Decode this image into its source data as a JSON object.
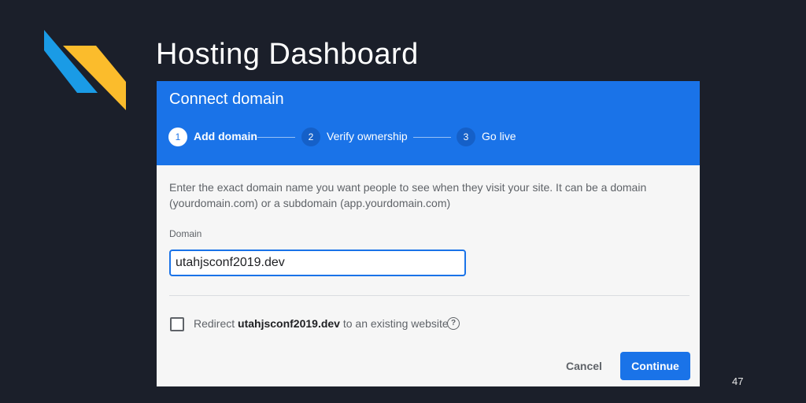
{
  "slide": {
    "title": "Hosting Dashboard",
    "page_number": "47",
    "colors": {
      "background": "#1b1f2a",
      "logo_blue": "#1a9be6",
      "logo_yellow": "#fbbc2c"
    }
  },
  "dialog": {
    "title": "Connect domain",
    "steps": [
      {
        "number": "1",
        "label": "Add domain",
        "state": "active"
      },
      {
        "number": "2",
        "label": "Verify ownership",
        "state": "inactive"
      },
      {
        "number": "3",
        "label": "Go live",
        "state": "inactive"
      }
    ],
    "description": "Enter the exact domain name you want people to see when they visit your site. It can be a domain (yourdomain.com) or a subdomain (app.yourdomain.com)",
    "domain_label": "Domain",
    "domain_value": "utahjsconf2019.dev",
    "redirect": {
      "checked": false,
      "prefix": "Redirect ",
      "domain": "utahjsconf2019.dev",
      "suffix": " to an existing website",
      "help_icon": "help-circle-icon"
    },
    "cancel_label": "Cancel",
    "continue_label": "Continue",
    "colors": {
      "header": "#1a73e8",
      "primary": "#1a73e8",
      "body": "#f6f6f6"
    }
  }
}
